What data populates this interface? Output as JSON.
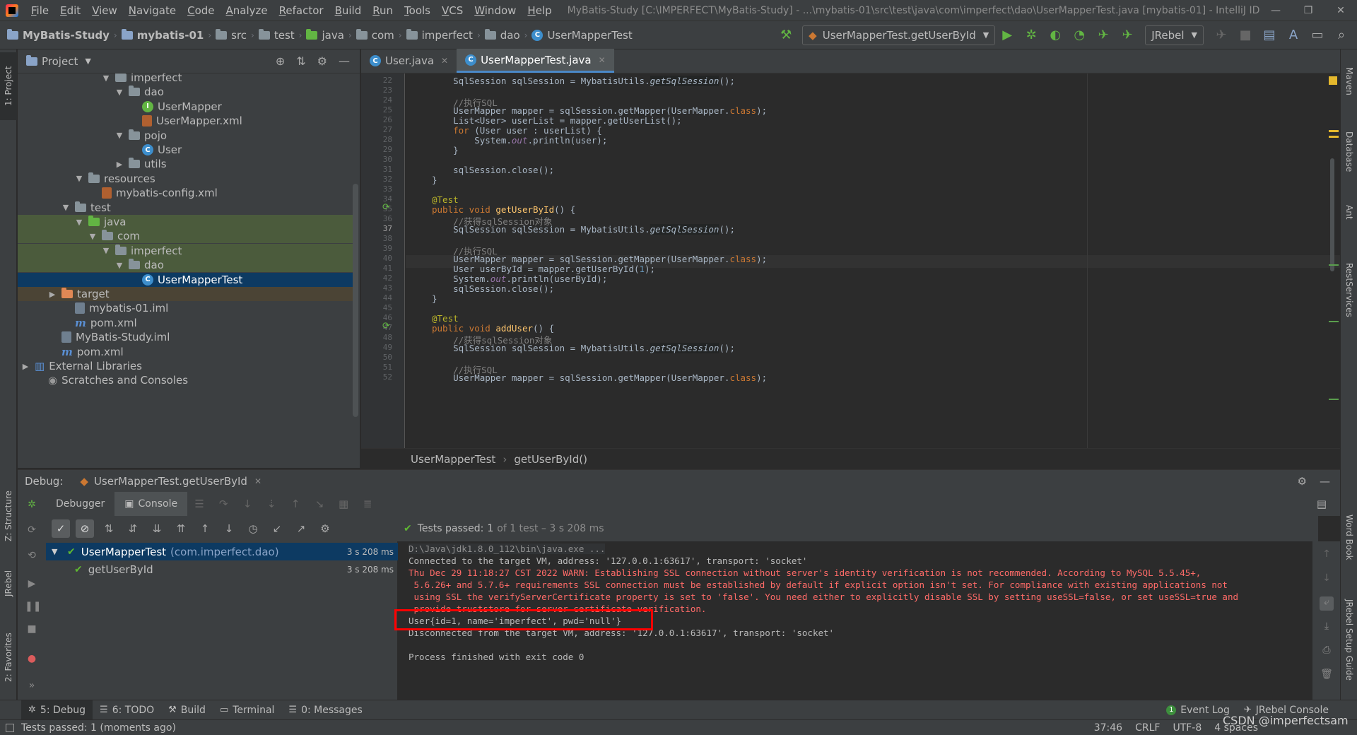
{
  "menu": {
    "items": [
      "File",
      "Edit",
      "View",
      "Navigate",
      "Code",
      "Analyze",
      "Refactor",
      "Build",
      "Run",
      "Tools",
      "VCS",
      "Window",
      "Help"
    ],
    "window_title": "MyBatis-Study [C:\\IMPERFECT\\MyBatis-Study] - ...\\mybatis-01\\src\\test\\java\\com\\imperfect\\dao\\UserMapperTest.java [mybatis-01] - IntelliJ IDEA"
  },
  "navbar": {
    "crumbs": [
      "MyBatis-Study",
      "mybatis-01",
      "src",
      "test",
      "java",
      "com",
      "imperfect",
      "dao",
      "UserMapperTest"
    ],
    "run_config": "UserMapperTest.getUserById",
    "jrebel": "JRebel"
  },
  "left_strip": {
    "project": "1: Project",
    "structure": "Z: Structure",
    "jrebel": "JRebel",
    "favorites": "2: Favorites"
  },
  "right_strip": {
    "maven": "Maven",
    "database": "Database",
    "ant": "Ant",
    "rest": "RestServices",
    "wordbook": "Word Book",
    "jrebel_guide": "JRebel Setup Guide"
  },
  "project": {
    "title": "Project",
    "tree": [
      {
        "label": "imperfect",
        "indent": 6,
        "kind": "folder",
        "arrow": "▼"
      },
      {
        "label": "dao",
        "indent": 7,
        "kind": "folder",
        "arrow": "▼"
      },
      {
        "label": "UserMapper",
        "indent": 8,
        "kind": "iface",
        "arrow": ""
      },
      {
        "label": "UserMapper.xml",
        "indent": 8,
        "kind": "xml",
        "arrow": ""
      },
      {
        "label": "pojo",
        "indent": 7,
        "kind": "folder",
        "arrow": "▼"
      },
      {
        "label": "User",
        "indent": 8,
        "kind": "class",
        "arrow": ""
      },
      {
        "label": "utils",
        "indent": 7,
        "kind": "folder",
        "arrow": "▶"
      },
      {
        "label": "resources",
        "indent": 4,
        "kind": "res",
        "arrow": "▼"
      },
      {
        "label": "mybatis-config.xml",
        "indent": 5,
        "kind": "xml",
        "arrow": ""
      },
      {
        "label": "test",
        "indent": 3,
        "kind": "folder",
        "arrow": "▼"
      },
      {
        "label": "java",
        "indent": 4,
        "kind": "green",
        "arrow": "▼",
        "hl": true
      },
      {
        "label": "com",
        "indent": 5,
        "kind": "folder",
        "arrow": "▼",
        "hl": true
      },
      {
        "label": "imperfect",
        "indent": 6,
        "kind": "folder",
        "arrow": "▼",
        "hl": true
      },
      {
        "label": "dao",
        "indent": 7,
        "kind": "folder",
        "arrow": "▼",
        "hl": true
      },
      {
        "label": "UserMapperTest",
        "indent": 8,
        "kind": "class",
        "arrow": "",
        "sel": true
      },
      {
        "label": "target",
        "indent": 2,
        "kind": "orange",
        "arrow": "▶",
        "tgt": true
      },
      {
        "label": "mybatis-01.iml",
        "indent": 3,
        "kind": "iml",
        "arrow": ""
      },
      {
        "label": "pom.xml",
        "indent": 3,
        "kind": "m",
        "arrow": ""
      },
      {
        "label": "MyBatis-Study.iml",
        "indent": 2,
        "kind": "iml",
        "arrow": ""
      },
      {
        "label": "pom.xml",
        "indent": 2,
        "kind": "m",
        "arrow": ""
      },
      {
        "label": "External Libraries",
        "indent": 0,
        "kind": "lib",
        "arrow": "▶"
      },
      {
        "label": "Scratches and Consoles",
        "indent": 1,
        "kind": "scratch",
        "arrow": ""
      }
    ]
  },
  "editor": {
    "tabs": [
      {
        "label": "User.java",
        "active": false
      },
      {
        "label": "UserMapperTest.java",
        "active": true
      }
    ],
    "line_numbers": [
      "22",
      "23",
      "24",
      "25",
      "26",
      "27",
      "28",
      "29",
      "30",
      "31",
      "32",
      "33",
      "34",
      "35",
      "36",
      "37",
      "38",
      "39",
      "40",
      "41",
      "42",
      "43",
      "44",
      "45",
      "46",
      "47",
      "48",
      "49",
      "50",
      "51",
      "52"
    ],
    "breadcrumb": [
      "UserMapperTest",
      "getUserById()"
    ]
  },
  "debug": {
    "label": "Debug:",
    "session": "UserMapperTest.getUserById",
    "tabs": [
      "Debugger",
      "Console"
    ],
    "status_prefix": "Tests passed:",
    "status_count": "1",
    "status_rest": "of 1 test – 3 s 208 ms",
    "tests": [
      {
        "name": "UserMapperTest",
        "pkg": "(com.imperfect.dao)",
        "time": "3 s 208 ms"
      },
      {
        "name": "getUserById",
        "pkg": "",
        "time": "3 s 208 ms"
      }
    ],
    "console": [
      {
        "text": "D:\\Java\\jdk1.8.0_112\\bin\\java.exe ...",
        "type": "cmd"
      },
      {
        "text": "Connected to the target VM, address: '127.0.0.1:63617', transport: 'socket'",
        "type": "out"
      },
      {
        "text": "Thu Dec 29 11:18:27 CST 2022 WARN: Establishing SSL connection without server's identity verification is not recommended. According to MySQL 5.5.45+,",
        "type": "err"
      },
      {
        "text": " 5.6.26+ and 5.7.6+ requirements SSL connection must be established by default if explicit option isn't set. For compliance with existing applications not",
        "type": "err"
      },
      {
        "text": " using SSL the verifyServerCertificate property is set to 'false'. You need either to explicitly disable SSL by setting useSSL=false, or set useSSL=true and",
        "type": "err"
      },
      {
        "text": " provide truststore for server certificate verification.",
        "type": "err"
      },
      {
        "text": "User{id=1, name='imperfect', pwd='null'}",
        "type": "out"
      },
      {
        "text": "Disconnected from the target VM, address: '127.0.0.1:63617', transport: 'socket'",
        "type": "out"
      },
      {
        "text": "",
        "type": "out"
      },
      {
        "text": "Process finished with exit code 0",
        "type": "out"
      }
    ]
  },
  "bottom_tools": [
    "5: Debug",
    "6: TODO",
    "Build",
    "Terminal",
    "0: Messages",
    "Event Log",
    "JRebel Console"
  ],
  "status_bar": {
    "message": "Tests passed: 1 (moments ago)",
    "position": "37:46",
    "line_sep": "CRLF",
    "encoding": "UTF-8",
    "indent": "4 spaces"
  },
  "watermark": "CSDN @imperfectsam"
}
